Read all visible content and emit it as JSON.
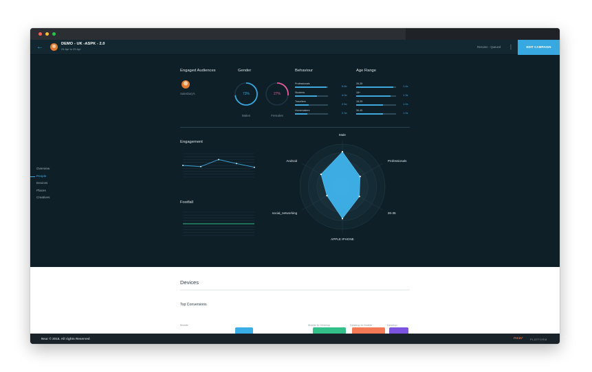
{
  "app": {
    "campaign_title": "DEMO - UK -ASPK - 2.0",
    "campaign_dates": "24 Apr to 25 Apr",
    "status": "Resume - Queued",
    "edit_button": "EDIT CAMPAIGN"
  },
  "colors": {
    "accent": "#38a8e0",
    "pink": "#e85c9c",
    "green": "#2fbf88",
    "dark_bg": "#0e1f28"
  },
  "sidenav": {
    "items": [
      {
        "label": "Overview",
        "active": false
      },
      {
        "label": "People",
        "active": true
      },
      {
        "label": "Devices",
        "active": false
      },
      {
        "label": "Places",
        "active": false
      },
      {
        "label": "Creatives",
        "active": false
      }
    ]
  },
  "sections": {
    "engaged_audiences": "Engaged Audiences",
    "gender": "Gender",
    "behaviour": "Behaviour",
    "age_range": "Age Range",
    "engagement": "Engagement",
    "footfall": "Footfall"
  },
  "audience": {
    "name": "Sainsbury's"
  },
  "gender": {
    "males": {
      "label": "Males",
      "percent_text": "73%",
      "value": 73
    },
    "females": {
      "label": "Females",
      "percent_text": "27%",
      "value": 27
    }
  },
  "behaviour": [
    {
      "label": "Professionals",
      "value_text": "5.8x",
      "value": 5.8
    },
    {
      "label": "Students",
      "value_text": "4.0x",
      "value": 4.0
    },
    {
      "label": "Travellers",
      "value_text": "2.5x",
      "value": 2.5
    },
    {
      "label": "Homemakers",
      "value_text": "2.3x",
      "value": 2.3
    }
  ],
  "age_range": [
    {
      "label": "26-35",
      "value_text": "1.4x",
      "value": 1.4
    },
    {
      "label": "18+",
      "value_text": "1.3x",
      "value": 1.3
    },
    {
      "label": "18-25",
      "value_text": "1.0x",
      "value": 1.0
    },
    {
      "label": "36-45",
      "value_text": "1.0x",
      "value": 1.0
    }
  ],
  "chart_data": [
    {
      "type": "line",
      "title": "Engagement",
      "x": [
        1,
        2,
        3,
        4,
        5
      ],
      "series": [
        {
          "values": [
            0.5,
            0.45,
            0.75,
            0.58,
            0.42
          ]
        }
      ],
      "grid": true
    },
    {
      "type": "line",
      "title": "Footfall",
      "x": [
        1,
        2
      ],
      "series": [
        {
          "values": [
            0.5,
            0.5
          ]
        }
      ],
      "grid": true
    },
    {
      "type": "radar",
      "axes": [
        "Male",
        "Professionals",
        "26-35",
        "APPLE IPHONE",
        "social_networking",
        "Android"
      ],
      "series": [
        {
          "values": [
            0.82,
            0.48,
            0.46,
            0.75,
            0.42,
            0.58
          ]
        }
      ],
      "rings": 5
    }
  ],
  "devices": {
    "title": "Devices",
    "top_conversions": "Top Conversions",
    "labels": [
      {
        "text": "Mobile"
      },
      {
        "text": "Mobile to Desktop"
      },
      {
        "text": "Desktop to Mobile"
      },
      {
        "text": "Desktop"
      }
    ]
  },
  "footer": {
    "copyright": "Near © 2015. All rights Reserved",
    "logo": "near",
    "platform": "PLATFORM"
  }
}
